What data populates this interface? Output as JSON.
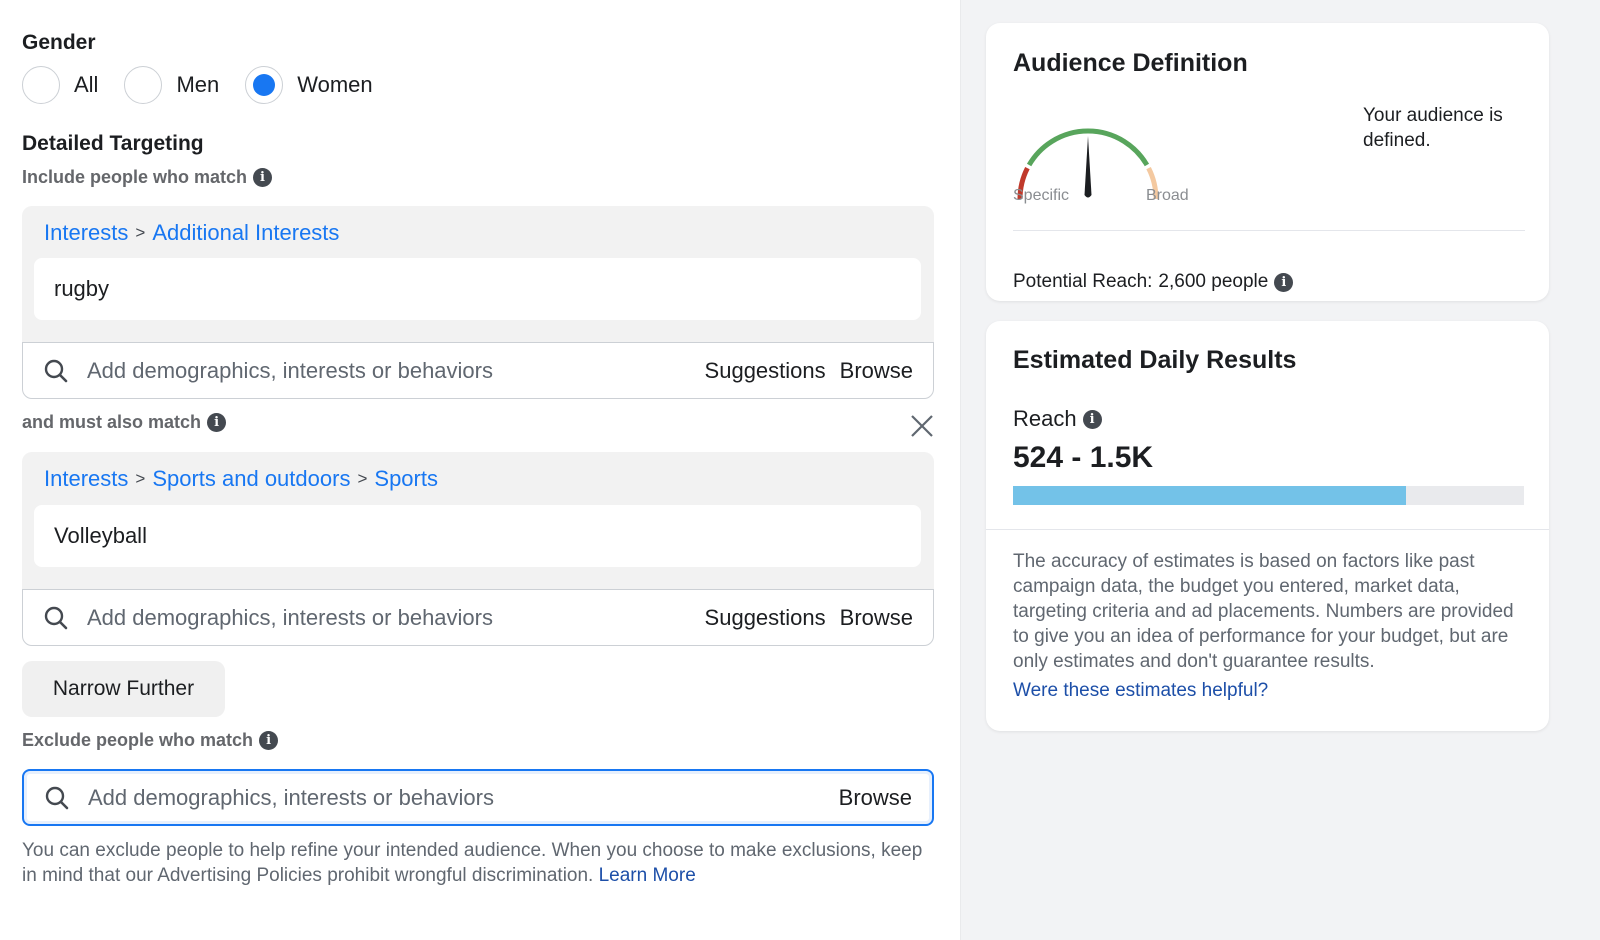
{
  "gender": {
    "label": "Gender",
    "options": [
      {
        "label": "All",
        "selected": false
      },
      {
        "label": "Men",
        "selected": false
      },
      {
        "label": "Women",
        "selected": true
      }
    ]
  },
  "detailed_targeting": {
    "title": "Detailed Targeting",
    "include_label": "Include people who match",
    "include_group": {
      "breadcrumb": [
        "Interests",
        "Additional Interests"
      ],
      "separator": ">",
      "selected_item": "rugby",
      "search_placeholder": "Add demographics, interests or behaviors",
      "suggestions_label": "Suggestions",
      "browse_label": "Browse"
    },
    "must_match_label": "and must also match",
    "must_match_group": {
      "breadcrumb": [
        "Interests",
        "Sports and outdoors",
        "Sports"
      ],
      "separator": ">",
      "selected_item": "Volleyball",
      "search_placeholder": "Add demographics, interests or behaviors",
      "suggestions_label": "Suggestions",
      "browse_label": "Browse"
    },
    "narrow_further_label": "Narrow Further",
    "exclude_label": "Exclude people who match",
    "exclude_search": {
      "placeholder": "Add demographics, interests or behaviors",
      "browse_label": "Browse"
    },
    "exclusion_note": "You can exclude people to help refine your intended audience. When you choose to make exclusions, keep in mind that our Advertising Policies prohibit wrongful discrimination.",
    "learn_more_label": "Learn More"
  },
  "audience_definition": {
    "title": "Audience Definition",
    "gauge": {
      "left_label": "Specific",
      "right_label": "Broad",
      "needle_position": 0.5,
      "colors": {
        "specific": "#c0392b",
        "defined": "#58a55c",
        "broad": "#f4c9a0",
        "needle": "#1c1e21"
      }
    },
    "status_text": "Your audience is defined.",
    "potential_reach_label": "Potential Reach:",
    "potential_reach_value": "2,600 people"
  },
  "estimated_daily_results": {
    "title": "Estimated Daily Results",
    "reach_label": "Reach",
    "reach_value": "524 - 1.5K",
    "reach_bar_fraction": 0.77,
    "reach_bar_color": "#73c2e8",
    "accuracy_note": "The accuracy of estimates is based on factors like past campaign data, the budget you entered, market data, targeting criteria and ad placements. Numbers are provided to give you an idea of performance for your budget, but are only estimates and don't guarantee results.",
    "feedback_link": "Were these estimates helpful?"
  },
  "colors": {
    "accent": "#1877f2",
    "link": "#1d4fa8",
    "panel_background": "#f2f3f5"
  }
}
